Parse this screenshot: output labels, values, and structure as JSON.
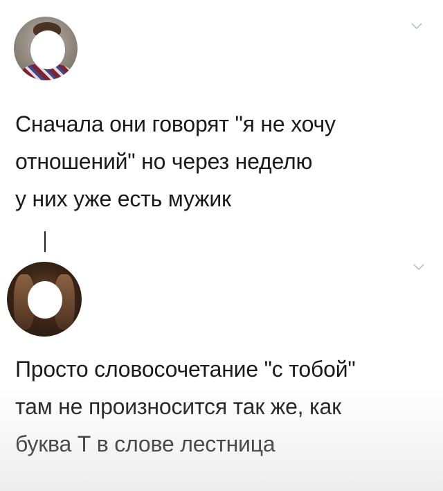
{
  "posts": [
    {
      "avatar": "user-avatar",
      "menu_icon": "chevron-down-icon",
      "lines": [
        "Сначала они говорят \"я не хочу",
        "отношений\" но через неделю",
        "у них уже есть мужик"
      ]
    },
    {
      "avatar": "user-avatar",
      "menu_icon": "chevron-down-icon",
      "lines": [
        "Просто словосочетание \"с тобой\"",
        "там не произносится так же, как",
        "буква Т в слове лестница"
      ]
    }
  ],
  "colors": {
    "text": "#1a1a1a",
    "chevron": "#b7bfc9",
    "thread_line": "#222222",
    "background": "#ffffff"
  }
}
